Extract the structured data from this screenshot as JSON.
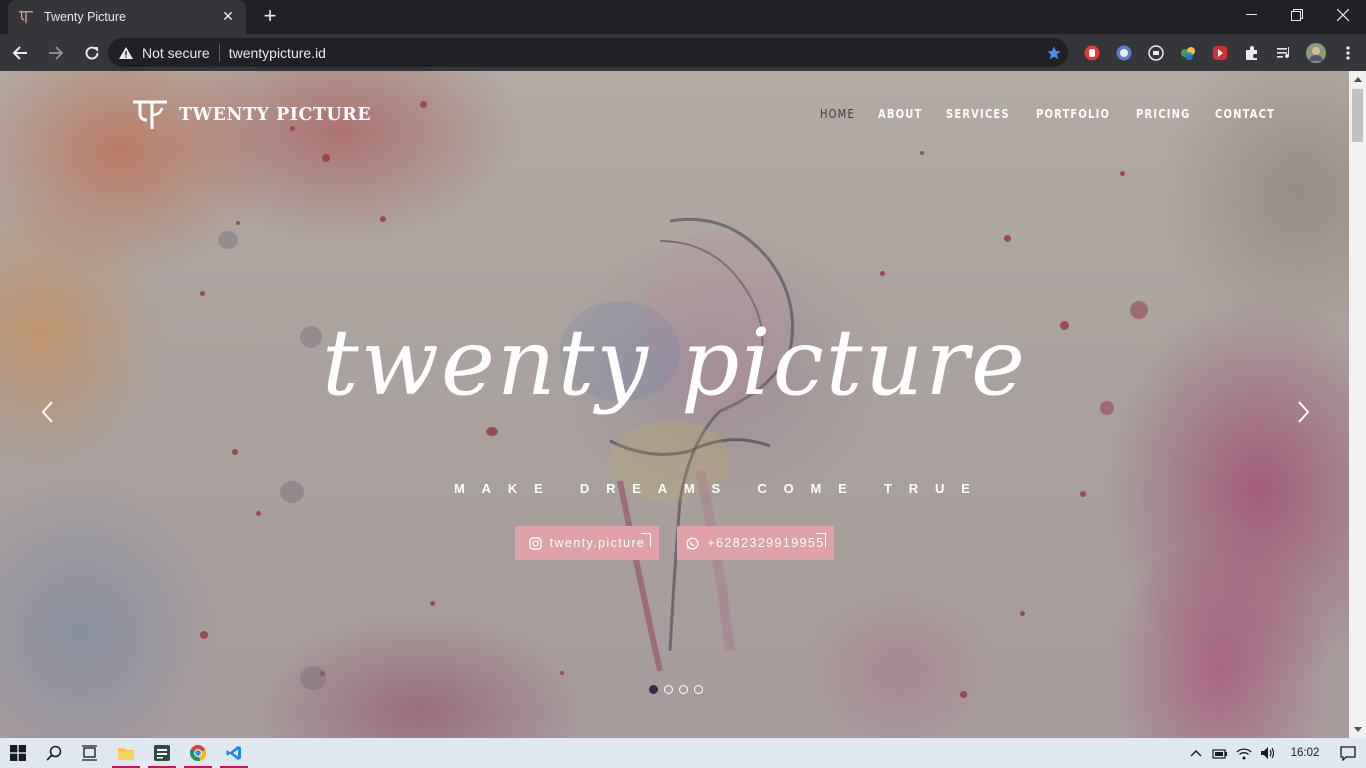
{
  "browser": {
    "tab": {
      "title": "Twenty Picture"
    },
    "omnibox": {
      "security_label": "Not secure",
      "url": "twentypicture.id"
    }
  },
  "site": {
    "logo_text": "TWENTY PICTURE",
    "nav": [
      {
        "label": "HOME",
        "active": true
      },
      {
        "label": "ABOUT"
      },
      {
        "label": "SERVICES"
      },
      {
        "label": "PORTFOLIO"
      },
      {
        "label": "PRICING"
      },
      {
        "label": "CONTACT"
      }
    ],
    "hero": {
      "script_title": "twenty picture",
      "tagline": "MAKE DREAMS COME TRUE",
      "instagram_label": "twenty.picture",
      "whatsapp_label": "+6282329919955",
      "slide_count": 4,
      "active_slide": 1
    },
    "accent_color": "#e0a1a8"
  },
  "taskbar": {
    "clock": "16:02"
  }
}
